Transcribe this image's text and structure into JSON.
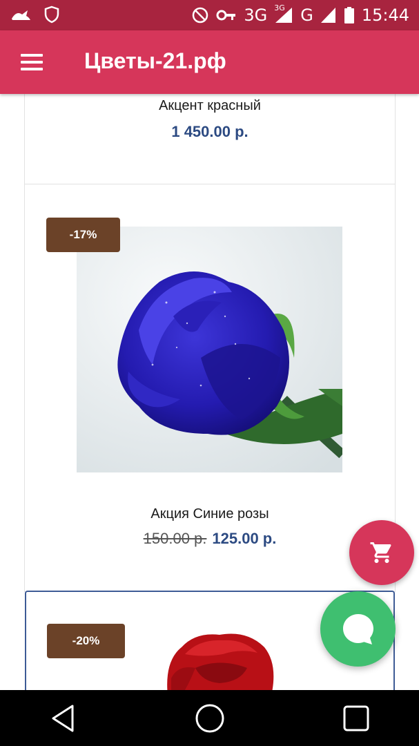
{
  "status_bar": {
    "network": "3G",
    "network_small": "3G",
    "network2": "G",
    "time": "15:44"
  },
  "app_bar": {
    "title": "Цветы-21.рф"
  },
  "products": [
    {
      "name": "Акцент красный",
      "price": "1 450.00 р."
    },
    {
      "badge": "-17%",
      "name": "Акция Синие розы",
      "old_price": "150.00 р.",
      "price": "125.00 р."
    },
    {
      "badge": "-20%"
    }
  ],
  "colors": {
    "status_bar": "#a8243f",
    "app_bar": "#d6365a",
    "price": "#2c4a82",
    "badge": "#6b4228",
    "cart_fab": "#d6365a",
    "chat_fab": "#3fbf70",
    "nav_bar": "#000000"
  },
  "icons": {
    "menu": "hamburger-icon",
    "cart": "shopping-cart-icon",
    "chat": "chat-bubble-icon",
    "back": "back-triangle-icon",
    "home": "home-circle-icon",
    "recents": "recents-square-icon"
  }
}
